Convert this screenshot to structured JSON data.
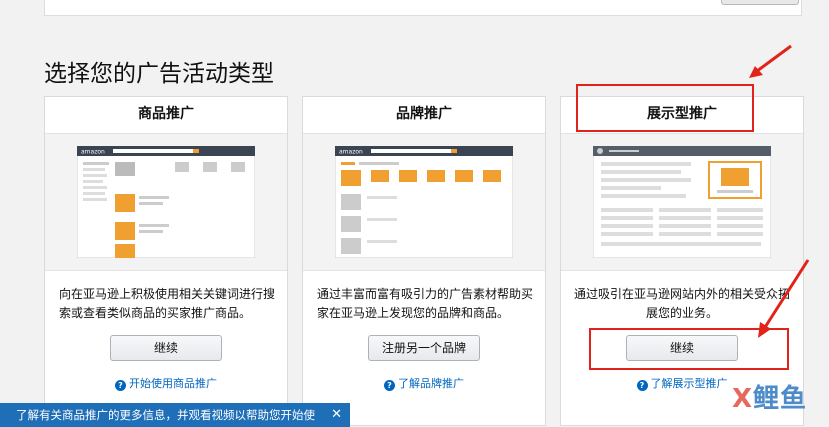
{
  "section_title": "选择您的广告活动类型",
  "cards": [
    {
      "title": "商品推广",
      "description": "向在亚马逊上积极使用相关关键词进行搜索或查看类似商品的买家推广商品。",
      "button": "继续",
      "help": "开始使用商品推广"
    },
    {
      "title": "品牌推广",
      "description": "通过丰富而富有吸引力的广告素材帮助买家在亚马逊上发现您的品牌和商品。",
      "button": "注册另一个品牌",
      "help": "了解品牌推广"
    },
    {
      "title": "展示型推广",
      "description": "通过吸引在亚马逊网站内外的相关受众拓展您的业务。",
      "button": "继续",
      "help": "了解展示型推广"
    }
  ],
  "info_banner": "了解有关商品推广的更多信息，并观看视频以帮助您开始使",
  "mockup_logo": "amazon",
  "watermark": {
    "x": "X",
    "rest": "鲤鱼"
  },
  "colors": {
    "annotation_red": "#e2231a",
    "link_blue": "#0066c0",
    "accent_orange": "#f0a030",
    "banner_blue": "#1f6fb8"
  }
}
